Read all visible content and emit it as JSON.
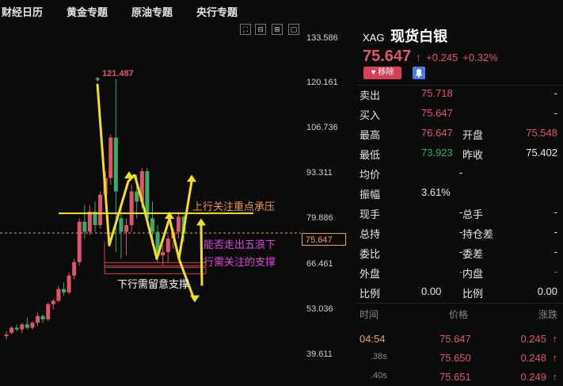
{
  "nav": [
    "财经日历",
    "黄金专题",
    "原油专题",
    "央行专题"
  ],
  "toolbar_icons": [
    "fit-icon",
    "zoom-out-icon",
    "zoom-in-icon",
    "fullscreen-icon"
  ],
  "chart": {
    "y_axis": [
      "133.586",
      "120.161",
      "106.736",
      "93.311",
      "79.886",
      "66.461",
      "53.036",
      "39.611"
    ],
    "current_price_label": "75.647",
    "peak_label": "121.487",
    "annotations": {
      "resistance": "上行关注重点承压",
      "five_waves_1": "能否走出五浪下",
      "five_waves_2": "行需关注的支撑",
      "support": "下行需留意支撑"
    }
  },
  "chart_data": {
    "type": "candlestick",
    "y_range": [
      39.611,
      133.586
    ],
    "y_ticks": [
      133.586,
      120.161,
      106.736,
      93.311,
      79.886,
      66.461,
      53.036,
      39.611
    ],
    "current_price": 75.647,
    "annotation_peak": 121.487,
    "resistance_level": 81.5,
    "support_level": 64.5,
    "candles": [
      {
        "o": 45.0,
        "h": 46.5,
        "l": 44.0,
        "c": 45.5
      },
      {
        "o": 46.0,
        "h": 48.0,
        "l": 45.5,
        "c": 47.5
      },
      {
        "o": 47.5,
        "h": 48.5,
        "l": 46.5,
        "c": 47.0
      },
      {
        "o": 47.0,
        "h": 49.0,
        "l": 46.0,
        "c": 48.5
      },
      {
        "o": 48.5,
        "h": 50.5,
        "l": 47.0,
        "c": 47.5
      },
      {
        "o": 47.5,
        "h": 49.5,
        "l": 47.0,
        "c": 49.0
      },
      {
        "o": 49.0,
        "h": 52.0,
        "l": 48.0,
        "c": 51.0
      },
      {
        "o": 51.0,
        "h": 51.5,
        "l": 49.0,
        "c": 50.0
      },
      {
        "o": 50.0,
        "h": 55.0,
        "l": 49.5,
        "c": 54.5
      },
      {
        "o": 54.5,
        "h": 56.0,
        "l": 53.0,
        "c": 55.5
      },
      {
        "o": 55.5,
        "h": 60.0,
        "l": 55.0,
        "c": 59.0
      },
      {
        "o": 59.0,
        "h": 61.0,
        "l": 57.0,
        "c": 58.0
      },
      {
        "o": 58.0,
        "h": 64.0,
        "l": 57.5,
        "c": 63.0
      },
      {
        "o": 63.0,
        "h": 68.0,
        "l": 62.0,
        "c": 67.0
      },
      {
        "o": 67.0,
        "h": 80.0,
        "l": 66.0,
        "c": 79.0
      },
      {
        "o": 79.0,
        "h": 84.0,
        "l": 74.0,
        "c": 76.0
      },
      {
        "o": 76.0,
        "h": 84.0,
        "l": 75.0,
        "c": 82.0
      },
      {
        "o": 82.0,
        "h": 85.0,
        "l": 76.0,
        "c": 78.0
      },
      {
        "o": 78.0,
        "h": 88.0,
        "l": 77.0,
        "c": 87.0
      },
      {
        "o": 87.0,
        "h": 94.0,
        "l": 86.0,
        "c": 92.0
      },
      {
        "o": 92.0,
        "h": 105.0,
        "l": 90.0,
        "c": 104.0
      },
      {
        "o": 104.0,
        "h": 121.487,
        "l": 70.0,
        "c": 88.0
      },
      {
        "o": 80.0,
        "h": 83.0,
        "l": 68.0,
        "c": 76.0
      },
      {
        "o": 76.0,
        "h": 80.0,
        "l": 69.0,
        "c": 78.0
      },
      {
        "o": 78.0,
        "h": 90.0,
        "l": 76.0,
        "c": 88.0
      },
      {
        "o": 88.0,
        "h": 93.0,
        "l": 80.0,
        "c": 85.0
      },
      {
        "o": 85.0,
        "h": 95.0,
        "l": 83.0,
        "c": 94.0
      },
      {
        "o": 94.0,
        "h": 95.0,
        "l": 78.0,
        "c": 80.0
      },
      {
        "o": 80.0,
        "h": 85.0,
        "l": 73.0,
        "c": 76.0
      },
      {
        "o": 76.0,
        "h": 78.0,
        "l": 67.0,
        "c": 69.0
      },
      {
        "o": 69.0,
        "h": 72.0,
        "l": 66.0,
        "c": 70.0
      },
      {
        "o": 70.0,
        "h": 75.0,
        "l": 67.0,
        "c": 74.0
      },
      {
        "o": 74.0,
        "h": 77.0,
        "l": 71.0,
        "c": 76.0
      },
      {
        "o": 76.0,
        "h": 82.0,
        "l": 74.0,
        "c": 80.5
      },
      {
        "o": 80.5,
        "h": 81.0,
        "l": 73.0,
        "c": 75.647
      }
    ],
    "colors": {
      "up": "#e0556a",
      "down": "#3daa6a",
      "resistance": "#f0e020",
      "support": "#d04040",
      "current": "#e8a04a"
    }
  },
  "quote": {
    "symbol": "XAG",
    "name": "现货白银",
    "last": "75.647",
    "change": "+0.245",
    "change_pct": "+0.32%",
    "remove_label": "移除",
    "rows": [
      {
        "l1": "卖出",
        "v1": "75.718",
        "l2": "",
        "v2": "-",
        "c1": "red",
        "c2": "white"
      },
      {
        "l1": "买入",
        "v1": "75.647",
        "l2": "",
        "v2": "-",
        "c1": "red",
        "c2": "white"
      },
      {
        "l1": "最高",
        "v1": "76.647",
        "l2": "开盘",
        "v2": "75.548",
        "c1": "red",
        "c2": "red"
      },
      {
        "l1": "最低",
        "v1": "73.923",
        "l2": "昨收",
        "v2": "75.402",
        "c1": "green",
        "c2": "white"
      },
      {
        "l1": "均价",
        "v1": "-",
        "l2": "",
        "v2": "",
        "c1": "white",
        "c2": "white"
      },
      {
        "l1": "振幅",
        "v1": "3.61%",
        "l2": "",
        "v2": "",
        "c1": "white",
        "c2": "white"
      },
      {
        "l1": "现手",
        "v1": "-",
        "l2": "总手",
        "v2": "-",
        "c1": "white",
        "c2": "white"
      },
      {
        "l1": "总持",
        "v1": "-",
        "l2": "持仓差",
        "v2": "-",
        "c1": "white",
        "c2": "white"
      },
      {
        "l1": "委比",
        "v1": "-",
        "l2": "委差",
        "v2": "-",
        "c1": "white",
        "c2": "white"
      },
      {
        "l1": "外盘",
        "v1": "-",
        "l2": "内盘",
        "v2": "-",
        "c1": "red",
        "c2": "green"
      },
      {
        "l1": "比例",
        "v1": "0.00",
        "l2": "比例",
        "v2": "0.00",
        "c1": "white",
        "c2": "white"
      }
    ],
    "ticks_header": [
      "时间",
      "价格",
      "涨跌"
    ],
    "ticks": [
      {
        "time": "04:54",
        "price": "75.647",
        "change": "0.245"
      },
      {
        "time": ".38s",
        "price": "75.650",
        "change": "0.248"
      },
      {
        "time": ".40s",
        "price": "75.651",
        "change": "0.249"
      }
    ]
  }
}
